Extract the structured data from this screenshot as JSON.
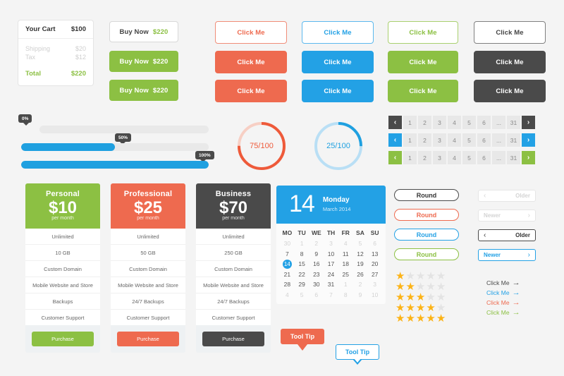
{
  "cart": {
    "title": "Your Cart",
    "title_amount": "$100",
    "lines": [
      {
        "label": "Shipping",
        "value": "$20"
      },
      {
        "label": "Tax",
        "value": "$12"
      }
    ],
    "total_label": "Total",
    "total_value": "$220"
  },
  "buy_buttons": [
    {
      "label": "Buy Now",
      "amount": "$220",
      "style": "ghost"
    },
    {
      "label": "Buy Now",
      "amount": "$220",
      "style": "green"
    },
    {
      "label": "Buy Now",
      "amount": "$220",
      "style": "green"
    }
  ],
  "click_buttons": {
    "label": "Click Me",
    "columns": [
      "red",
      "blue",
      "green",
      "dark"
    ],
    "rows": [
      "outline",
      "solid",
      "solid"
    ]
  },
  "sliders": [
    {
      "value": 0,
      "tooltip": "0%"
    },
    {
      "value": 50,
      "tooltip": "50%"
    },
    {
      "value": 100,
      "tooltip": "100%"
    }
  ],
  "donuts": [
    {
      "label": "75/100",
      "value": 75,
      "color": "#ee5a3a"
    },
    {
      "label": "25/100",
      "value": 25,
      "color": "#1fa0e0"
    }
  ],
  "pagination": {
    "prev_icon": "chevron-left-icon",
    "next_icon": "chevron-right-icon",
    "pages": [
      "1",
      "2",
      "3",
      "4",
      "5",
      "6",
      "...",
      "31"
    ],
    "rows": [
      "dark",
      "blue",
      "green"
    ]
  },
  "pricing": [
    {
      "name": "Personal",
      "price": "$10",
      "period": "per month",
      "color": "#8cc043",
      "features": [
        "Unlimited",
        "10 GB",
        "Custom Domain",
        "Mobile Website and Store",
        "Backups",
        "Customer Support"
      ],
      "button": "Purchase"
    },
    {
      "name": "Professional",
      "price": "$25",
      "period": "per month",
      "color": "#ee6a4f",
      "features": [
        "Unlimited",
        "50 GB",
        "Custom Domain",
        "Mobile Website and Store",
        "24/7 Backups",
        "Customer Support"
      ],
      "button": "Purchase"
    },
    {
      "name": "Business",
      "price": "$70",
      "period": "per month",
      "color": "#4a4a4a",
      "features": [
        "Unlimited",
        "250 GB",
        "Custom Domain",
        "Mobile Website and Store",
        "24/7 Backups",
        "Customer Support"
      ],
      "button": "Purchase"
    }
  ],
  "calendar": {
    "day_number": "14",
    "weekday": "Monday",
    "month_year": "March 2014",
    "dow": [
      "MO",
      "TU",
      "WE",
      "TH",
      "FR",
      "SA",
      "SU"
    ],
    "selected": "14",
    "weeks": [
      [
        {
          "d": "30",
          "m": true
        },
        {
          "d": "1",
          "m": true
        },
        {
          "d": "2",
          "m": true
        },
        {
          "d": "3",
          "m": true
        },
        {
          "d": "4",
          "m": true
        },
        {
          "d": "5",
          "m": true
        },
        {
          "d": "6",
          "m": true
        }
      ],
      [
        {
          "d": "7"
        },
        {
          "d": "8"
        },
        {
          "d": "9"
        },
        {
          "d": "10"
        },
        {
          "d": "11"
        },
        {
          "d": "12"
        },
        {
          "d": "13"
        }
      ],
      [
        {
          "d": "14",
          "s": true
        },
        {
          "d": "15"
        },
        {
          "d": "16"
        },
        {
          "d": "17"
        },
        {
          "d": "18"
        },
        {
          "d": "19"
        },
        {
          "d": "20"
        }
      ],
      [
        {
          "d": "21"
        },
        {
          "d": "22"
        },
        {
          "d": "23"
        },
        {
          "d": "24"
        },
        {
          "d": "25"
        },
        {
          "d": "26"
        },
        {
          "d": "27"
        }
      ],
      [
        {
          "d": "28"
        },
        {
          "d": "29"
        },
        {
          "d": "30"
        },
        {
          "d": "31"
        },
        {
          "d": "1",
          "m": true
        },
        {
          "d": "2",
          "m": true
        },
        {
          "d": "3",
          "m": true
        }
      ],
      [
        {
          "d": "4",
          "m": true
        },
        {
          "d": "5",
          "m": true
        },
        {
          "d": "6",
          "m": true
        },
        {
          "d": "7",
          "m": true
        },
        {
          "d": "8",
          "m": true
        },
        {
          "d": "9",
          "m": true
        },
        {
          "d": "10",
          "m": true
        }
      ]
    ]
  },
  "round_buttons": [
    {
      "label": "Round",
      "style": "dark"
    },
    {
      "label": "Round",
      "style": "red"
    },
    {
      "label": "Round",
      "style": "blue"
    },
    {
      "label": "Round",
      "style": "green"
    }
  ],
  "nav_buttons": [
    {
      "label": "Older",
      "dir": "prev",
      "style": "muted"
    },
    {
      "label": "Newer",
      "dir": "next",
      "style": "muted"
    },
    {
      "label": "Older",
      "dir": "prev",
      "style": "dark"
    },
    {
      "label": "Newer",
      "dir": "next",
      "style": "blue"
    }
  ],
  "star_ratings": {
    "max": 5,
    "rows": [
      1,
      2,
      3,
      4,
      5
    ],
    "on_color": "#fcb316",
    "off_color": "#e3e3e3"
  },
  "click_links": [
    {
      "label": "Click Me",
      "arrow": "→",
      "color": "#4a4a4a"
    },
    {
      "label": "Click Me",
      "arrow": "→",
      "color": "#23a1e5"
    },
    {
      "label": "Click Me",
      "arrow": "→",
      "color": "#ee6a4f"
    },
    {
      "label": "Click Me",
      "arrow": "→",
      "color": "#8cc043"
    }
  ],
  "tooltips": [
    {
      "label": "Tool Tip",
      "style": "red"
    },
    {
      "label": "Tool Tip",
      "style": "blue"
    }
  ],
  "colors": {
    "red": "#ee6a4f",
    "blue": "#23a1e5",
    "green": "#8cc043",
    "dark": "#4a4a4a",
    "background": "#f4f4f4"
  }
}
